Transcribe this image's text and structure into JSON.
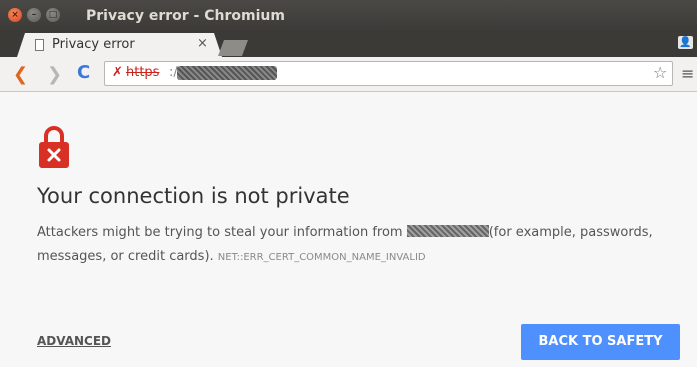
{
  "window": {
    "title": "Privacy error - Chromium",
    "buttons": {
      "close": "×",
      "minimize": "–",
      "maximize": "□"
    }
  },
  "tabs": [
    {
      "label": "Privacy error",
      "close": "×",
      "icon": "page-icon"
    }
  ],
  "toolbar": {
    "back": "❮",
    "forward": "❯",
    "reload": "C",
    "url_scheme": "https",
    "url_rest": ":/",
    "star": "☆",
    "menu": "≡",
    "lock_icon": "✗"
  },
  "page": {
    "heading": "Your connection is not private",
    "body_part1": "Attackers might be trying to steal your information from ",
    "body_part2": "(for example, passwords, messages, or credit cards).",
    "error_code": "NET::ERR_CERT_COMMON_NAME_INVALID",
    "advanced_label": "ADVANCED",
    "back_button_label": "BACK TO SAFETY"
  },
  "colors": {
    "accent": "#4d90fe",
    "error_red": "#d93025",
    "titlebar": "#3b3a37"
  }
}
